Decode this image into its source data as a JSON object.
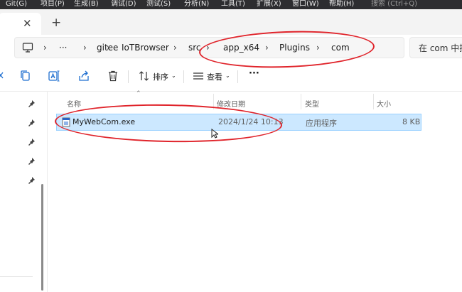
{
  "menubar": {
    "items": [
      "Git(G)",
      "项目(P)",
      "生成(B)",
      "调试(D)",
      "测试(S)",
      "分析(N)",
      "工具(T)",
      "扩展(X)",
      "窗口(W)",
      "帮助(H)"
    ],
    "search_label": "搜索 (Ctrl+Q)"
  },
  "tabstrip": {
    "close_glyph": "✕",
    "new_tab_glyph": "+"
  },
  "address": {
    "overflow_glyph": "···",
    "crumbs": [
      "gitee",
      "IoTBrowser",
      "src",
      "app_x64",
      "Plugins",
      "com"
    ],
    "search_placeholder": "在 com 中搜索"
  },
  "toolbar": {
    "sort_label": "排序",
    "view_label": "查看",
    "more_glyph": "···"
  },
  "columns": {
    "name": "名称",
    "date": "修改日期",
    "type": "类型",
    "size": "大小"
  },
  "files": [
    {
      "name": "MyWebCom.exe",
      "date": "2024/1/24 10:13",
      "type": "应用程序",
      "size": "8 KB"
    }
  ],
  "colors": {
    "selection_bg": "#cce8ff",
    "selection_border": "#99d1ff",
    "annotation_red": "#e0242b",
    "menubar_bg": "#2d2d30"
  }
}
